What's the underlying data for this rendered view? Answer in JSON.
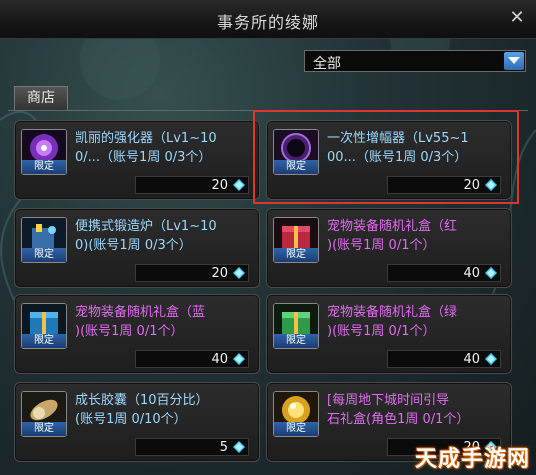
{
  "window": {
    "title": "事务所的绫娜"
  },
  "filter": {
    "selected": "全部"
  },
  "tabs": [
    {
      "label": "商店"
    }
  ],
  "badge_label": "限定",
  "items": [
    {
      "name": "凯丽的强化器（Lv1~10\n0/...（账号1周 0/3个）",
      "price": "20",
      "color": "blue",
      "icon": "purple-orb-icon"
    },
    {
      "name": "一次性增幅器（Lv55~1\n00...（账号1周 0/3个）",
      "price": "20",
      "color": "blue",
      "icon": "dark-orb-icon"
    },
    {
      "name": "便携式锻造炉（Lv1~10\n0)(账号1周 0/3个）",
      "price": "20",
      "color": "blue",
      "icon": "forge-icon"
    },
    {
      "name": "宠物装备随机礼盒（红\n)(账号1周 0/1个）",
      "price": "40",
      "color": "purple",
      "icon": "red-giftbox-icon"
    },
    {
      "name": "宠物装备随机礼盒（蓝\n)(账号1周 0/1个）",
      "price": "40",
      "color": "purple",
      "icon": "blue-giftbox-icon"
    },
    {
      "name": "宠物装备随机礼盒（绿\n)(账号1周 0/1个）",
      "price": "40",
      "color": "purple",
      "icon": "green-giftbox-icon"
    },
    {
      "name": "成长胶囊（10百分比）\n(账号1周 0/10个）",
      "price": "5",
      "color": "blue",
      "icon": "capsule-icon"
    },
    {
      "name": "[每周地下城时间引导\n石礼盒(角色1周 0/1个）",
      "price": "20",
      "color": "purple",
      "icon": "gold-orb-icon"
    }
  ],
  "currency_icon": "blue-gem-icon",
  "watermark": "天成手游网",
  "colors": {
    "highlight": "#e03434",
    "name_blue": "#9ad8ff",
    "name_purple": "#e06cf0"
  }
}
